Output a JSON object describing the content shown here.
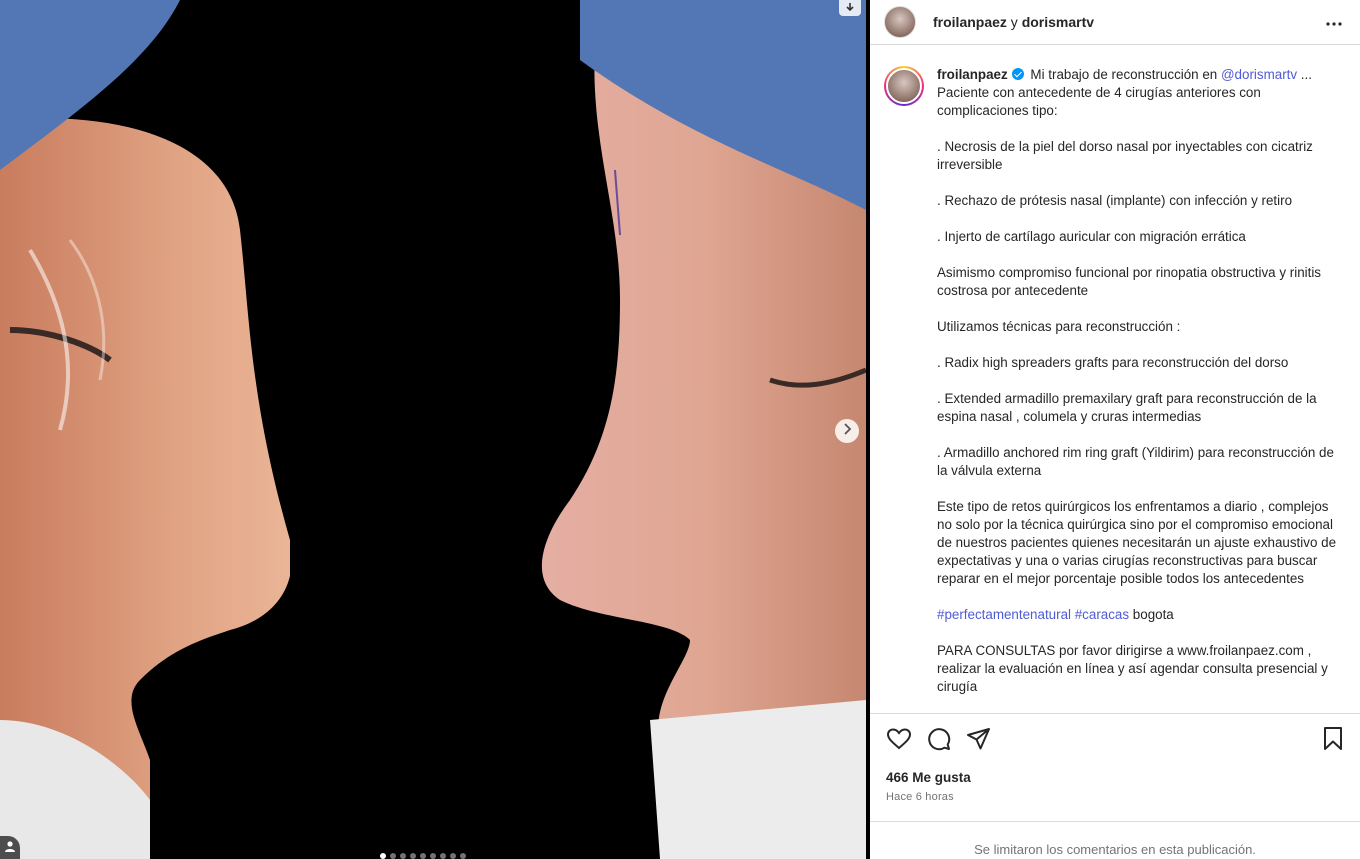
{
  "header": {
    "account_1": "froilanpaez",
    "connector": " y ",
    "account_2": "dorismartv"
  },
  "caption": {
    "username": "froilanpaez",
    "intro": "Mi trabajo de reconstrucción en ",
    "mention": "@dorismartv",
    "ellipsis": " ...",
    "paragraphs": [
      "Paciente con antecedente de 4 cirugías anteriores con complicaciones tipo:",
      ". Necrosis de la piel del dorso nasal por inyectables con cicatriz irreversible",
      ". Rechazo de prótesis nasal (implante) con infección y retiro",
      ". Injerto de cartílago auricular con migración errática",
      "Asimismo compromiso funcional por rinopatia obstructiva y rinitis costrosa por antecedente",
      "Utilizamos técnicas para reconstrucción :",
      ". Radix high spreaders grafts para reconstrucción del dorso",
      ". Extended armadillo premaxilary graft para reconstrucción de la espina nasal , columela y cruras intermedias",
      ". Armadillo anchored rim ring graft (Yildirim) para reconstrucción de la válvula externa",
      "Este tipo de retos quirúrgicos los enfrentamos a diario , complejos no solo por la técnica quirúrgica sino por el compromiso emocional de nuestros pacientes quienes necesitarán un ajuste exhaustivo de expectativas y una o varias cirugías reconstructivas para buscar reparar en el mejor porcentaje posible todos los antecedentes"
    ],
    "hashtag_1": "#perfectamentenatural",
    "hashtag_2": "#caracas",
    "hashtag_tail": " bogota",
    "consult": "PARA CONSULTAS por favor dirigirse a www.froilanpaez.com , realizar la evaluación en línea y así agendar consulta presencial y cirugía"
  },
  "stats": {
    "likes": "466 Me gusta",
    "time": "Hace 6 horas"
  },
  "comments_note": "Se limitaron los comentarios en esta publicación.",
  "carousel": {
    "count": 9,
    "active_index": 0
  },
  "icons": {
    "like": "heart-icon",
    "comment": "comment-icon",
    "share": "share-icon",
    "save": "bookmark-icon",
    "more": "more-icon",
    "next": "chevron-right-icon"
  }
}
